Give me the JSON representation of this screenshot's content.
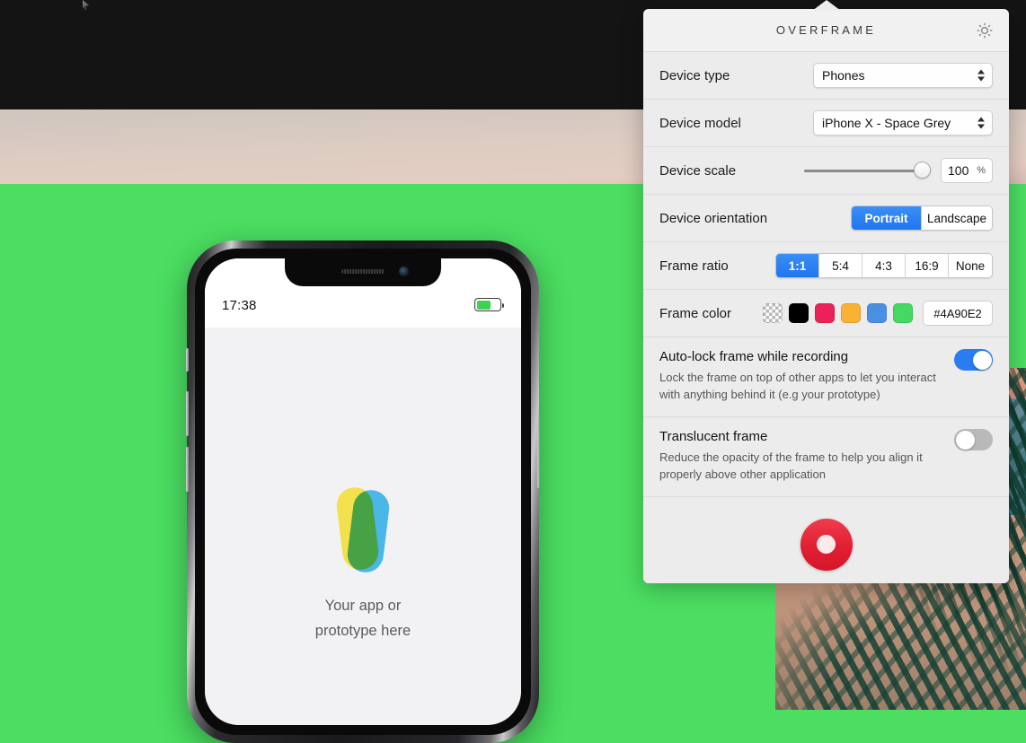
{
  "desktop": {
    "wallpaper_name": "tropical-beach-palm-photo"
  },
  "phone": {
    "status_time": "17:38",
    "battery_icon": "battery-icon",
    "app_caption_line1": "Your app or",
    "app_caption_line2": "prototype here",
    "logo_name": "app-placeholder-logo"
  },
  "popover": {
    "title": "OVERFRAME",
    "settings_icon": "gear-icon",
    "rows": {
      "device_type": {
        "label": "Device type",
        "value": "Phones"
      },
      "device_model": {
        "label": "Device model",
        "value": "iPhone X - Space Grey"
      },
      "device_scale": {
        "label": "Device scale",
        "value": "100",
        "unit": "%",
        "slider_percent": 100
      },
      "device_orientation": {
        "label": "Device orientation",
        "options": [
          "Portrait",
          "Landscape"
        ],
        "selected": "Portrait"
      },
      "frame_ratio": {
        "label": "Frame ratio",
        "options": [
          "1:1",
          "5:4",
          "4:3",
          "16:9",
          "None"
        ],
        "selected": "1:1"
      },
      "frame_color": {
        "label": "Frame color",
        "swatches": [
          "transparent",
          "#000000",
          "#EC2158",
          "#F9B233",
          "#4A90E2",
          "#45D862"
        ],
        "hex_value": "#4A90E2",
        "selected_index": 5
      }
    },
    "toggles": [
      {
        "title": "Auto-lock frame while recording",
        "description": "Lock the frame on top of other apps to let you interact with anything behind it (e.g your prototype)",
        "state": "on"
      },
      {
        "title": "Translucent frame",
        "description": "Reduce the opacity of the frame to help you align it properly above other application",
        "state": "off"
      }
    ],
    "record_button": "record-button"
  }
}
